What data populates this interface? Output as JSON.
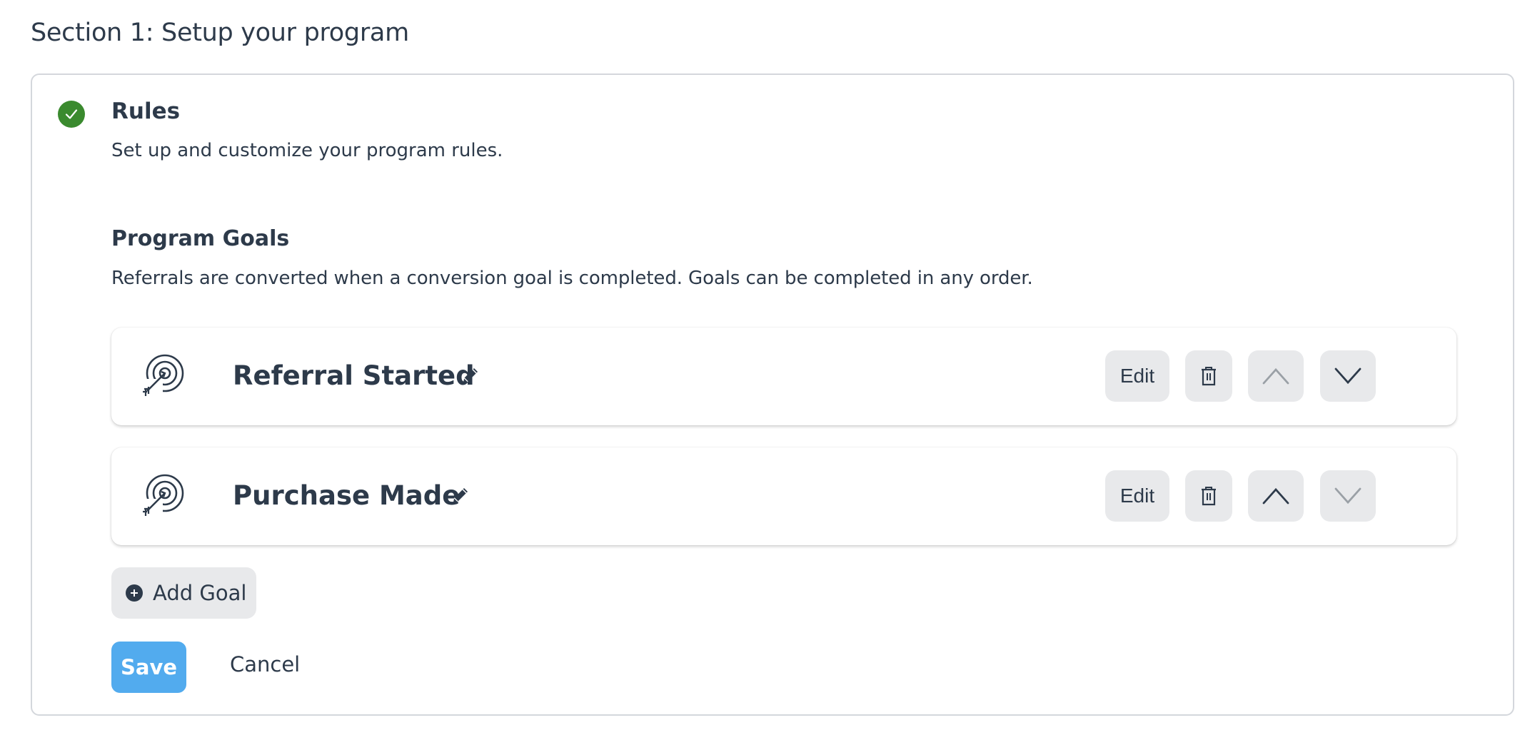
{
  "section": {
    "title": "Section 1: Setup your program"
  },
  "rules": {
    "title": "Rules",
    "description": "Set up and customize your program rules.",
    "status": "complete"
  },
  "program_goals": {
    "title": "Program Goals",
    "description": "Referrals are converted when a conversion goal is completed. Goals can be completed in any order.",
    "goals": [
      {
        "name": "Referral Started",
        "edit_label": "Edit",
        "move_up_enabled": false,
        "move_down_enabled": true
      },
      {
        "name": "Purchase Made",
        "edit_label": "Edit",
        "move_up_enabled": true,
        "move_down_enabled": false
      }
    ],
    "add_goal_label": "Add Goal"
  },
  "actions": {
    "save_label": "Save",
    "cancel_label": "Cancel"
  },
  "colors": {
    "text": "#2d3a4a",
    "success": "#3a8a2e",
    "primary": "#52abee",
    "button_bg": "#e8e9eb",
    "disabled_icon": "#9aa0a6",
    "border": "#d4d7dc"
  }
}
